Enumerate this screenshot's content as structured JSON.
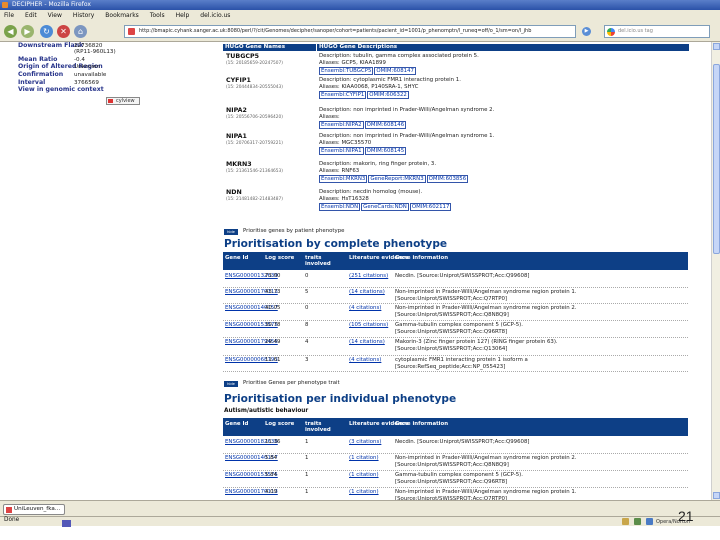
{
  "window": {
    "title": "DECIPHER - Mozilla Firefox"
  },
  "menu": [
    "File",
    "Edit",
    "View",
    "History",
    "Bookmarks",
    "Tools",
    "Help",
    "del.icio.us"
  ],
  "nav": {
    "url": "http://bmapic.cyhank.sanger.ac.uk:8080/perl/?/cit/Genomes/decipher/sanoper/cohort=patients/pacient_id=1001/p_phenomptn/l_runeq=off/o_1/sm=on/l_jhb",
    "search_placeholder": "del.icio.us tag"
  },
  "left": {
    "rows": [
      {
        "label": "Downstream Flank",
        "value": "22736820"
      },
      {
        "label": "",
        "value": "(RP11-960L13)"
      },
      {
        "label": "Mean Ratio",
        "value": "-0.4"
      },
      {
        "label": "Origin of Altered Region",
        "value": "Unknown"
      },
      {
        "label": "Confirmation",
        "value": "unavailable"
      },
      {
        "label": "Interval",
        "value": "3766569"
      },
      {
        "label": "View in genomic context",
        "value": ""
      }
    ],
    "cylview": "cylview"
  },
  "genes": {
    "hdr_name": "HUGO Gene Names",
    "hdr_desc": "HUGO Gene Descriptions",
    "items": [
      {
        "name": "TUBGCP5",
        "pos": "(15: 20185659-20247507)",
        "desc": "Description: tubulin, gamma complex associated protein 5.",
        "aliases": "Aliases: GCP5, KIAA1899",
        "links": [
          "Ensembl:TUBGCP5",
          "OMIM:608147"
        ]
      },
      {
        "name": "CYFIP1",
        "pos": "(15: 20444834-20555043)",
        "desc": "Description: cytoplasmic FMR1 interacting protein 1.",
        "aliases": "Aliases: KIAA0068, P140SRA-1, SHYC",
        "links": [
          "Ensembl:CYFIP1",
          "OMIM:606322"
        ]
      },
      {
        "name": "NIPA2",
        "pos": "(15: 20556706-20596420)",
        "desc": "Description: non imprinted in Prader-Willi/Angelman syndrome 2.",
        "aliases": "Aliases:",
        "links": [
          "Ensembl:NIPA2",
          "OMIM:608146"
        ]
      },
      {
        "name": "NIPA1",
        "pos": "(15: 20706317-20759221)",
        "desc": "Description: non imprinted in Prader-Willi/Angelman syndrome 1.",
        "aliases": "Aliases: MGC35570",
        "links": [
          "Ensembl:NIPA1",
          "OMIM:608145"
        ]
      },
      {
        "name": "MKRN3",
        "pos": "(15: 21361546-21364653)",
        "desc": "Description: makorin, ring finger protein, 3.",
        "aliases": "Aliases: RNF63",
        "links": [
          "Ensembl:MKRN3",
          "GeneReport:MKRN3",
          "OMIM:603856"
        ]
      },
      {
        "name": "NDN",
        "pos": "(15: 21481482-21483487)",
        "desc": "Description: necdin homolog (mouse).",
        "aliases": "Aliases: HsT16328",
        "links": [
          "Ensembl:NDN",
          "GeneCards:NDN",
          "OMIM:602117"
        ]
      }
    ]
  },
  "badges": {
    "b1_tag": "hide",
    "b1_text": "Prioritise genes by patient phenotype",
    "b2_tag": "hide",
    "b2_text": "Prioritise Genes per phenotype trait"
  },
  "prio_complete": {
    "title": "Prioritisation by complete phenotype",
    "headers": [
      "Gene Id",
      "Log score",
      "traits involved",
      "Literature evidence",
      "Gene information"
    ],
    "rows": [
      {
        "id": "ENSG00000132639",
        "score": "73.00",
        "traits": "0",
        "evidence": "(251 citations)",
        "info": [
          "Necdin. [Source:Uniprot/SWISSPROT;Acc:Q99608]"
        ]
      },
      {
        "id": "ENSG00000170113",
        "score": "43.73",
        "traits": "5",
        "evidence": "(14 citations)",
        "info": [
          "Non-imprinted in Prader-Willi/Angelman syndrome region protein 1.",
          "[Source:Uniprot/SWISSPROT;Acc:Q7RTP0]"
        ]
      },
      {
        "id": "ENSG00000140157",
        "score": "40.05",
        "traits": "0",
        "evidence": "(4 citations)",
        "info": [
          "Non-imprinted in Prader-Willi/Angelman syndrome region protein 2.",
          "[Source:Uniprot/SWISSPROT;Acc:Q8N8Q9]"
        ]
      },
      {
        "id": "ENSG00000153575",
        "score": "30.78",
        "traits": "8",
        "evidence": "(105 citations)",
        "info": [
          "Gamma-tubulin complex component 5 (GCP-5).",
          "[Source:Uniprot/SWISSPROT;Acc:Q96RT8]"
        ]
      },
      {
        "id": "ENSG00000179455",
        "score": "29.49",
        "traits": "4",
        "evidence": "(14 citations)",
        "info": [
          "Makorin-3 (Zinc finger protein 127) (RING finger protein 63).",
          "[Source:Uniprot/SWISSPROT;Acc:Q13064]"
        ]
      },
      {
        "id": "ENSG00000068793",
        "score": "11.61",
        "traits": "3",
        "evidence": "(4 citations)",
        "info": [
          "cytoplasmic FMR1 interacting protein 1 isoform a",
          "[Source:RefSeq_peptide;Acc:NP_055423]"
        ]
      }
    ]
  },
  "prio_individual": {
    "title": "Prioritisation per individual phenotype",
    "subtitle": "Autism/autistic behaviour",
    "headers": [
      "Gene Id",
      "Log score",
      "traits involved",
      "Literature evidence",
      "Gene information"
    ],
    "rows": [
      {
        "id": "ENSG00000182636",
        "score": "11.36",
        "traits": "1",
        "evidence": "(3 citations)",
        "info": [
          "Necdin. [Source:Uniprot/SWISSPROT;Acc:Q99608]"
        ]
      },
      {
        "id": "ENSG00000140157",
        "score": "5.84",
        "traits": "1",
        "evidence": "(1 citation)",
        "info": [
          "Non-imprinted in Prader-Willi/Angelman syndrome region protein 2.",
          "[Source:Uniprot/SWISSPROT;Acc:Q8N8Q9]"
        ]
      },
      {
        "id": "ENSG00000153575",
        "score": "5.84",
        "traits": "1",
        "evidence": "(1 citation)",
        "info": [
          "Gamma-tubulin complex component 5 (GCP-5).",
          "[Source:Uniprot/SWISSPROT;Acc:Q96RT8]"
        ]
      },
      {
        "id": "ENSG00000170113",
        "score": "4.09",
        "traits": "1",
        "evidence": "(1 citation)",
        "info": [
          "Non-imprinted in Prader-Willi/Angelman syndrome region protein 1.",
          "[Source:Uniprot/SWISSPROT;Acc:Q7RTP0]"
        ]
      }
    ]
  },
  "status": {
    "tab": "UniLeuven_fka...",
    "done": "Done",
    "tray": "Opera/Norton",
    "slide": "21"
  }
}
